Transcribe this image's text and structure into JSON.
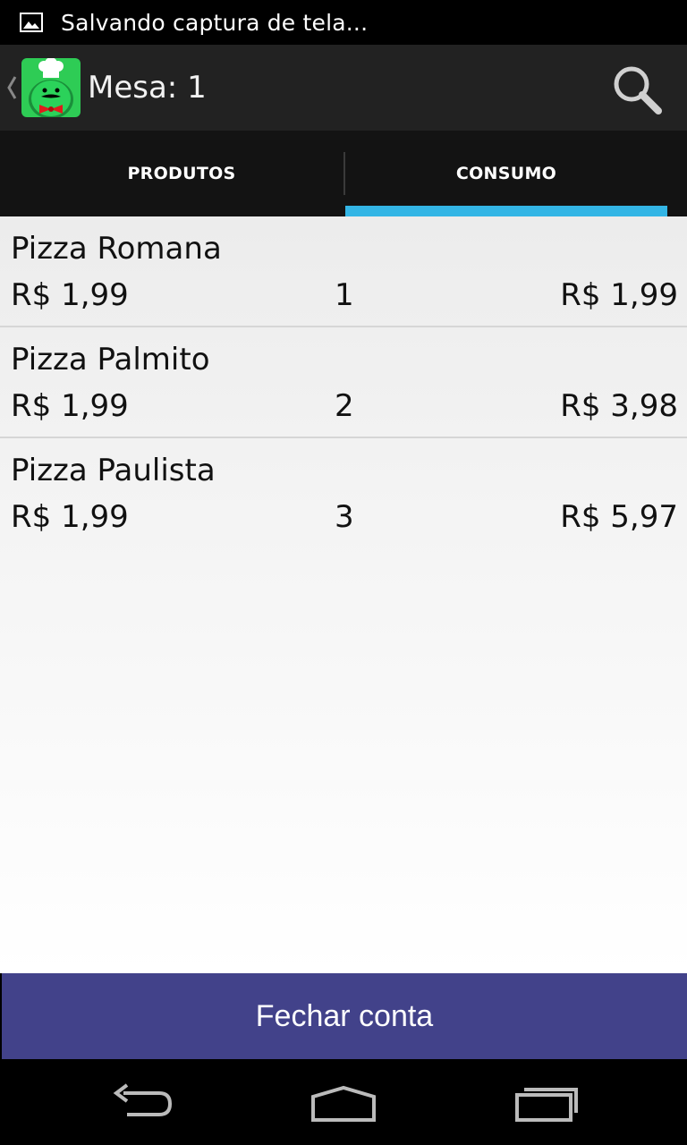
{
  "status_bar": {
    "notification_icon": "image-icon",
    "text": "Salvando captura de tela..."
  },
  "action_bar": {
    "up_icon": "chevron-left-icon",
    "logo": "chef-mascot-logo",
    "title": "Mesa: 1",
    "search_icon": "search-icon"
  },
  "tabs": [
    {
      "label": "PRODUTOS",
      "selected": false
    },
    {
      "label": "CONSUMO",
      "selected": true
    }
  ],
  "colors": {
    "tab_indicator": "#33b5e5",
    "primary_button": "#42428a",
    "logo_green": "#2ecc55"
  },
  "items": [
    {
      "name": "Pizza Romana",
      "unit_price": "R$ 1,99",
      "quantity": "1",
      "total": "R$ 1,99"
    },
    {
      "name": "Pizza Palmito",
      "unit_price": "R$ 1,99",
      "quantity": "2",
      "total": "R$ 3,98"
    },
    {
      "name": "Pizza Paulista",
      "unit_price": "R$ 1,99",
      "quantity": "3",
      "total": "R$ 5,97"
    }
  ],
  "footer": {
    "close_label": "Fechar conta"
  },
  "nav_bar": {
    "back_icon": "back-icon",
    "home_icon": "home-icon",
    "recent_icon": "recent-apps-icon"
  }
}
